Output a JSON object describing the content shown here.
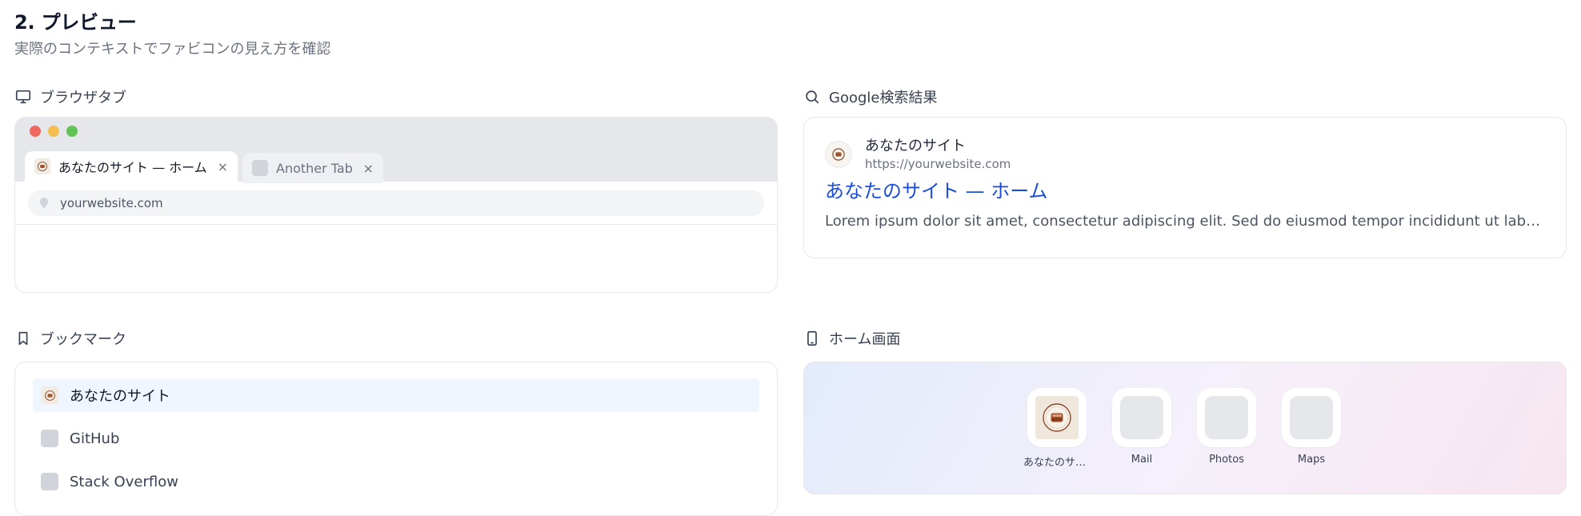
{
  "section": {
    "title": "2. プレビュー",
    "subtitle": "実際のコンテキストでファビコンの見え方を確認"
  },
  "browser_tab": {
    "heading": "ブラウザタブ",
    "icon": "monitor-icon",
    "window_controls": {
      "close": "#ee6a5f",
      "minimize": "#f5bd4f",
      "zoom": "#61c454"
    },
    "tabs": [
      {
        "label": "あなたのサイト — ホーム",
        "close": "×"
      },
      {
        "label": "Another Tab",
        "close": "×"
      }
    ],
    "address": "yourwebsite.com"
  },
  "google_result": {
    "heading": "Google検索結果",
    "icon": "search-icon",
    "site_name": "あなたのサイト",
    "url": "https://yourwebsite.com",
    "title": "あなたのサイト — ホーム",
    "description": "Lorem ipsum dolor sit amet, consectetur adipiscing elit. Sed do eiusmod tempor incididunt ut labore et dolore magna aliqua.",
    "link_color": "#1d4ed8"
  },
  "bookmarks": {
    "heading": "ブックマーク",
    "icon": "bookmark-icon",
    "items": [
      {
        "label": "あなたのサイト"
      },
      {
        "label": "GitHub"
      },
      {
        "label": "Stack Overflow"
      }
    ]
  },
  "home_screen": {
    "heading": "ホーム画面",
    "icon": "phone-icon",
    "apps": [
      {
        "label": "あなたのサイト"
      },
      {
        "label": "Mail"
      },
      {
        "label": "Photos"
      },
      {
        "label": "Maps"
      }
    ]
  }
}
